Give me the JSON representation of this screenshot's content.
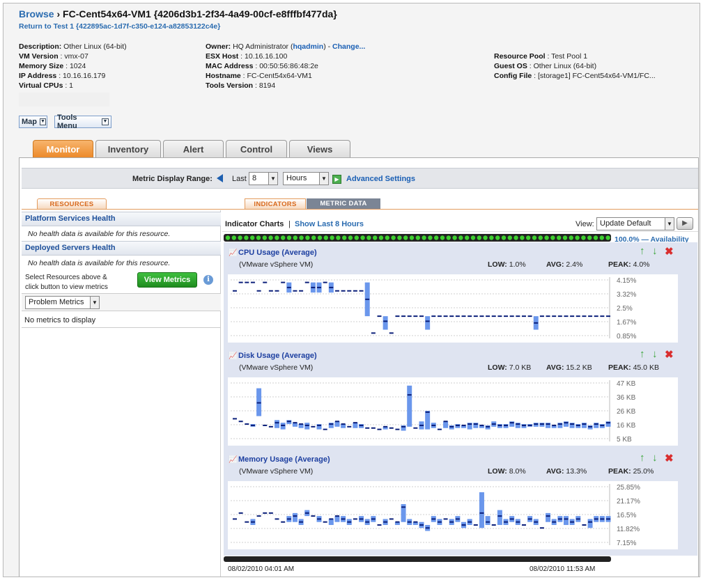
{
  "breadcrumb": {
    "browse": "Browse",
    "separator": "›",
    "title": "FC-Cent54x64-VM1 {4206d3b1-2f34-4a49-00cf-e8fffbf477da}",
    "return_link": "Return to Test 1 {422895ac-1d7f-c350-e124-a82853122c4e}"
  },
  "properties": {
    "col1": [
      {
        "label": "Description:",
        "value": " Other Linux (64-bit)"
      },
      {
        "label": "VM Version",
        "value": " : vmx-07"
      },
      {
        "label": "Memory Size",
        "value": " : 1024"
      },
      {
        "label": "IP Address",
        "value": " : 10.16.16.179"
      },
      {
        "label": "Virtual CPUs",
        "value": " : 1"
      }
    ],
    "col2": [
      {
        "label": "ESX Host",
        "value": " : 10.16.16.100"
      },
      {
        "label": "MAC Address",
        "value": " : 00:50:56:86:48:2e"
      },
      {
        "label": "Hostname",
        "value": " : FC-Cent54x64-VM1"
      },
      {
        "label": "Tools Version",
        "value": " : 8194"
      }
    ],
    "owner": {
      "label": "Owner:",
      "value": " HQ Administrator (",
      "user": "hqadmin",
      "close": ") - ",
      "change": "Change..."
    },
    "col3": [
      {
        "label": "Resource Pool",
        "value": " : Test Pool 1"
      },
      {
        "label": "Guest OS",
        "value": " : Other Linux (64-bit)"
      },
      {
        "label": "Config File",
        "value": " : [storage1] FC-Cent54x64-VM1/FC..."
      }
    ]
  },
  "menus": {
    "map": "Map",
    "tools": "Tools Menu"
  },
  "tabs": [
    "Monitor",
    "Inventory",
    "Alert",
    "Control",
    "Views"
  ],
  "range": {
    "label": "Metric Display Range:",
    "last": "Last",
    "count": "8",
    "unit": "Hours",
    "advanced": "Advanced Settings"
  },
  "subtabs": {
    "resources": "RESOURCES",
    "indicators": "INDICATORS",
    "metric_data": "METRIC DATA"
  },
  "left": {
    "platform_title": "Platform Services Health",
    "platform_msg": "No health data is available for this resource.",
    "deployed_title": "Deployed Servers Health",
    "deployed_msg": "No health data is available for this resource.",
    "select_hint": "Select Resources above &",
    "select_hint2": "click button to view metrics",
    "view_metrics": "View Metrics",
    "info": "i",
    "problem_metrics": "Problem Metrics",
    "no_metrics": "No metrics to display"
  },
  "indicators": {
    "title": "Indicator Charts",
    "sep": "|",
    "show_last": "Show Last 8 Hours",
    "view_label": "View:",
    "view_value": "Update Default",
    "availability": "100.0% — Availability"
  },
  "charts": [
    {
      "title": "CPU Usage (Average)",
      "subtitle": "(VMware vSphere VM)",
      "low_l": "LOW:",
      "low": " 1.0%",
      "avg_l": "AVG:",
      "avg": " 2.4%",
      "peak_l": "PEAK:",
      "peak": " 4.0%",
      "ticks": [
        "4.15%",
        "3.32%",
        "2.5%",
        "1.67%",
        "0.85%"
      ]
    },
    {
      "title": "Disk Usage (Average)",
      "subtitle": "(VMware vSphere VM)",
      "low_l": "LOW:",
      "low": " 7.0 KB",
      "avg_l": "AVG:",
      "avg": " 15.2 KB",
      "peak_l": "PEAK:",
      "peak": " 45.0 KB",
      "ticks": [
        "47 KB",
        "36 KB",
        "26 KB",
        "16 KB",
        "5 KB"
      ]
    },
    {
      "title": "Memory Usage (Average)",
      "subtitle": "(VMware vSphere VM)",
      "low_l": "LOW:",
      "low": " 8.0%",
      "avg_l": "AVG:",
      "avg": " 13.3%",
      "peak_l": "PEAK:",
      "peak": " 25.0%",
      "ticks": [
        "25.85%",
        "21.17%",
        "16.5%",
        "11.82%",
        "7.15%"
      ]
    }
  ],
  "time_start": "08/02/2010 04:01 AM",
  "time_end": "08/02/2010 11:53 AM",
  "colors": {
    "bar": "#6b97ec",
    "dot": "#0b1f7a",
    "grid": "#cfcfcf",
    "tab_active": "#ec8a2a"
  },
  "chart_data": [
    {
      "type": "bar",
      "name": "CPU Usage (Average)",
      "ylim": [
        0.85,
        4.15
      ],
      "series": [
        {
          "name": "avg",
          "values": [
            3.5,
            4.0,
            4.0,
            4.0,
            3.5,
            4.0,
            3.5,
            3.5,
            4.0,
            3.7,
            3.5,
            3.5,
            4.0,
            3.7,
            3.7,
            4.0,
            3.7,
            3.5,
            3.5,
            3.5,
            3.5,
            3.5,
            3.0,
            1.0,
            2.0,
            1.7,
            1.0,
            2.0,
            2.0,
            2.0,
            2.0,
            2.0,
            1.7,
            2.0,
            2.0,
            2.0,
            2.0,
            2.0,
            2.0,
            2.0,
            2.0,
            2.0,
            2.0,
            2.0,
            2.0,
            2.0,
            2.0,
            2.0,
            2.0,
            2.0,
            1.6,
            2.0,
            2.0,
            2.0,
            2.0,
            2.0,
            2.0,
            2.0,
            2.0,
            2.0,
            2.0,
            2.0,
            2.0
          ]
        },
        {
          "name": "high",
          "values": [
            3.5,
            4.0,
            4.0,
            4.0,
            3.5,
            4.0,
            3.5,
            3.5,
            4.0,
            4.0,
            3.5,
            3.5,
            4.0,
            4.0,
            4.0,
            4.0,
            4.0,
            3.5,
            3.5,
            3.5,
            3.5,
            3.5,
            4.0,
            1.0,
            2.0,
            2.0,
            1.0,
            2.0,
            2.0,
            2.0,
            2.0,
            2.0,
            2.0,
            2.0,
            2.0,
            2.0,
            2.0,
            2.0,
            2.0,
            2.0,
            2.0,
            2.0,
            2.0,
            2.0,
            2.0,
            2.0,
            2.0,
            2.0,
            2.0,
            2.0,
            2.0,
            2.0,
            2.0,
            2.0,
            2.0,
            2.0,
            2.0,
            2.0,
            2.0,
            2.0,
            2.0,
            2.0,
            2.0
          ]
        },
        {
          "name": "low",
          "values": [
            3.5,
            4.0,
            4.0,
            4.0,
            3.5,
            4.0,
            3.5,
            3.5,
            4.0,
            3.4,
            3.5,
            3.5,
            4.0,
            3.4,
            3.4,
            4.0,
            3.4,
            3.5,
            3.5,
            3.5,
            3.5,
            3.5,
            2.0,
            1.0,
            2.0,
            1.2,
            1.0,
            2.0,
            2.0,
            2.0,
            2.0,
            2.0,
            1.2,
            2.0,
            2.0,
            2.0,
            2.0,
            2.0,
            2.0,
            2.0,
            2.0,
            2.0,
            2.0,
            2.0,
            2.0,
            2.0,
            2.0,
            2.0,
            2.0,
            2.0,
            1.2,
            2.0,
            2.0,
            2.0,
            2.0,
            2.0,
            2.0,
            2.0,
            2.0,
            2.0,
            2.0,
            2.0,
            2.0
          ]
        }
      ]
    },
    {
      "type": "bar",
      "name": "Disk Usage (Average)",
      "ylim": [
        5,
        47
      ],
      "series": [
        {
          "name": "avg",
          "values": [
            20,
            18,
            16,
            15,
            32,
            15,
            14,
            17,
            15,
            18,
            17,
            16,
            15,
            14,
            15,
            12,
            16,
            18,
            16,
            14,
            17,
            15,
            13,
            13,
            12,
            14,
            13,
            12,
            14,
            38,
            13,
            15,
            25,
            15,
            12,
            18,
            14,
            15,
            15,
            16,
            16,
            15,
            14,
            16,
            15,
            15,
            17,
            16,
            15,
            15,
            16,
            16,
            16,
            15,
            16,
            17,
            16,
            15,
            16,
            14,
            16,
            15,
            17
          ]
        },
        {
          "name": "high",
          "values": [
            20,
            18,
            16,
            16,
            43,
            15,
            14,
            19,
            17,
            19,
            17,
            16,
            17,
            14,
            16,
            12,
            17,
            18,
            16,
            14,
            17,
            16,
            13,
            13,
            12,
            14,
            13,
            12,
            15,
            45,
            13,
            18,
            26,
            17,
            12,
            18,
            15,
            16,
            15,
            17,
            17,
            15,
            15,
            18,
            16,
            16,
            18,
            17,
            16,
            16,
            17,
            17,
            17,
            15,
            17,
            18,
            17,
            16,
            17,
            15,
            17,
            16,
            18
          ]
        },
        {
          "name": "low",
          "values": [
            20,
            18,
            16,
            14,
            22,
            15,
            14,
            13,
            12,
            16,
            14,
            13,
            12,
            14,
            12,
            12,
            13,
            14,
            13,
            14,
            13,
            13,
            13,
            13,
            12,
            12,
            13,
            12,
            11,
            14,
            13,
            12,
            12,
            13,
            12,
            13,
            12,
            13,
            13,
            12,
            13,
            13,
            12,
            14,
            13,
            13,
            14,
            13,
            13,
            14,
            14,
            14,
            13,
            13,
            13,
            14,
            13,
            13,
            13,
            12,
            13,
            13,
            14
          ]
        }
      ]
    },
    {
      "type": "bar",
      "name": "Memory Usage (Average)",
      "ylim": [
        7.15,
        25.85
      ],
      "series": [
        {
          "name": "avg",
          "values": [
            15,
            17,
            14,
            14,
            16,
            17,
            17,
            15,
            14,
            15,
            16,
            14,
            17,
            16,
            15,
            14,
            15,
            16,
            15,
            14,
            15,
            15,
            14,
            15,
            13,
            14,
            15,
            14,
            19,
            14,
            14,
            13,
            12,
            15,
            14,
            15,
            14,
            15,
            13,
            14,
            13,
            17,
            14,
            13,
            16,
            14,
            15,
            14,
            13,
            15,
            14,
            12,
            16,
            14,
            15,
            15,
            14,
            15,
            13,
            14,
            15,
            15,
            15
          ]
        },
        {
          "name": "high",
          "values": [
            15,
            17,
            14,
            15,
            16,
            17,
            17,
            15,
            14,
            16,
            17,
            15,
            18,
            16,
            16,
            14,
            15,
            16,
            16,
            15,
            15,
            16,
            15,
            16,
            13,
            15,
            15,
            14,
            20,
            15,
            14,
            14,
            13,
            16,
            15,
            15,
            15,
            16,
            14,
            15,
            13,
            24,
            16,
            13,
            18,
            15,
            16,
            15,
            13,
            16,
            15,
            12,
            17,
            15,
            16,
            16,
            15,
            16,
            13,
            15,
            16,
            16,
            16
          ]
        },
        {
          "name": "low",
          "values": [
            15,
            17,
            14,
            13,
            16,
            17,
            17,
            15,
            14,
            14,
            14,
            13,
            16,
            16,
            14,
            14,
            13,
            14,
            14,
            13,
            15,
            14,
            13,
            14,
            13,
            13,
            15,
            13,
            14,
            13,
            13,
            12,
            11,
            14,
            13,
            15,
            13,
            14,
            12,
            13,
            13,
            12,
            13,
            13,
            13,
            13,
            14,
            13,
            13,
            14,
            13,
            12,
            14,
            13,
            14,
            13,
            13,
            14,
            13,
            12,
            14,
            14,
            14
          ]
        }
      ]
    }
  ]
}
